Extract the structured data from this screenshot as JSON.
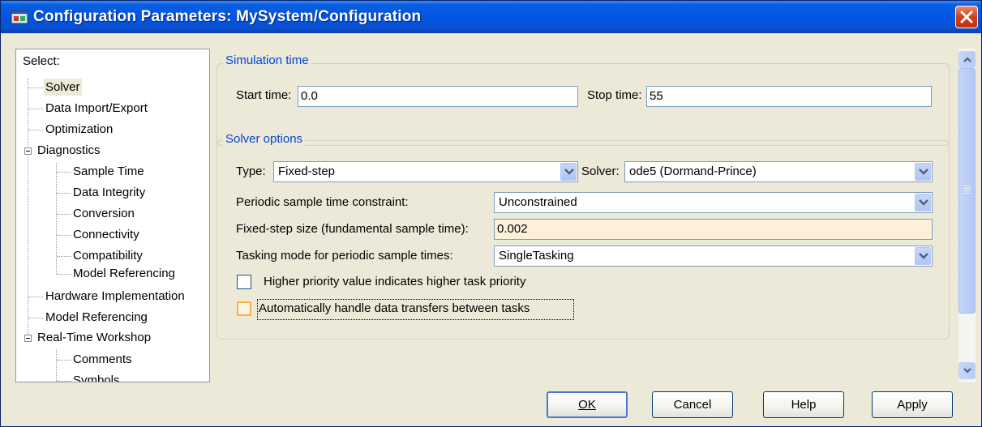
{
  "window": {
    "title": "Configuration Parameters: MySystem/Configuration"
  },
  "tree": {
    "header": "Select:",
    "items": [
      {
        "label": "Solver",
        "level": 1,
        "selected": true
      },
      {
        "label": "Data Import/Export",
        "level": 1
      },
      {
        "label": "Optimization",
        "level": 1
      },
      {
        "label": "Diagnostics",
        "level": 1,
        "expanded": true
      },
      {
        "label": "Sample Time",
        "level": 2
      },
      {
        "label": "Data Integrity",
        "level": 2
      },
      {
        "label": "Conversion",
        "level": 2
      },
      {
        "label": "Connectivity",
        "level": 2
      },
      {
        "label": "Compatibility",
        "level": 2
      },
      {
        "label": "Model Referencing",
        "level": 2
      },
      {
        "label": "Hardware Implementation",
        "level": 1
      },
      {
        "label": "Model Referencing",
        "level": 1
      },
      {
        "label": "Real-Time Workshop",
        "level": 1,
        "expanded": true
      },
      {
        "label": "Comments",
        "level": 2
      },
      {
        "label": "Symbols",
        "level": 2
      }
    ]
  },
  "simulation_time": {
    "title": "Simulation time",
    "start_label": "Start time:",
    "start_value": "0.0",
    "stop_label": "Stop time:",
    "stop_value": "55"
  },
  "solver_options": {
    "title": "Solver options",
    "type_label": "Type:",
    "type_value": "Fixed-step",
    "solver_label": "Solver:",
    "solver_value": "ode5 (Dormand-Prince)",
    "periodic_label": "Periodic sample time constraint:",
    "periodic_value": "Unconstrained",
    "stepsize_label": "Fixed-step size (fundamental sample time):",
    "stepsize_value": "0.002",
    "tasking_label": "Tasking mode for periodic sample times:",
    "tasking_value": "SingleTasking",
    "priority_checkbox_label": "Higher priority value indicates higher task priority",
    "priority_checked": false,
    "transfer_checkbox_label": "Automatically handle data transfers between tasks",
    "transfer_checked": false
  },
  "buttons": {
    "ok": "OK",
    "cancel": "Cancel",
    "help": "Help",
    "apply": "Apply"
  },
  "colors": {
    "titlebar": "#0055e5",
    "window_bg": "#ece9d8",
    "group_title": "#0046d5",
    "highlight_field": "#fdf0da"
  }
}
